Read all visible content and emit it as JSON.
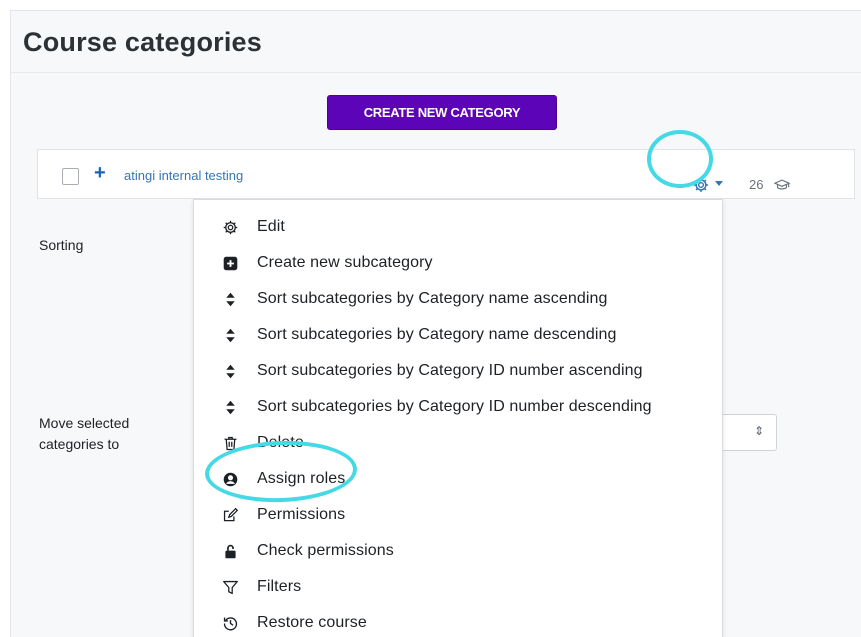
{
  "page": {
    "title": "Course categories",
    "create_button_label": "CREATE NEW CATEGORY"
  },
  "category": {
    "expand_symbol": "+",
    "name": "atingi internal testing",
    "course_count": "26",
    "actions_icon": "gear-icon",
    "count_icon": "graduation-cap-icon"
  },
  "sidebar": {
    "sorting_label": "Sorting",
    "move_label": "Move selected categories to",
    "select_arrows": "⇕"
  },
  "menu": {
    "items": [
      {
        "label": "Edit",
        "icon": "gear-icon"
      },
      {
        "label": "Create new subcategory",
        "icon": "plus-square-icon"
      },
      {
        "label": "Sort subcategories by Category name ascending",
        "icon": "sort-icon"
      },
      {
        "label": "Sort subcategories by Category name descending",
        "icon": "sort-icon"
      },
      {
        "label": "Sort subcategories by Category ID number ascending",
        "icon": "sort-icon"
      },
      {
        "label": "Sort subcategories by Category ID number descending",
        "icon": "sort-icon"
      },
      {
        "label": "Delete",
        "icon": "trash-icon"
      },
      {
        "label": "Assign roles",
        "icon": "user-circle-icon"
      },
      {
        "label": "Permissions",
        "icon": "edit-icon"
      },
      {
        "label": "Check permissions",
        "icon": "unlock-icon"
      },
      {
        "label": "Filters",
        "icon": "filter-icon"
      },
      {
        "label": "Restore course",
        "icon": "restore-icon"
      }
    ]
  },
  "annotations": {
    "highlight_color": "#43d9e6"
  },
  "colors": {
    "button_bg": "#5c04b8",
    "link": "#3675b4"
  }
}
